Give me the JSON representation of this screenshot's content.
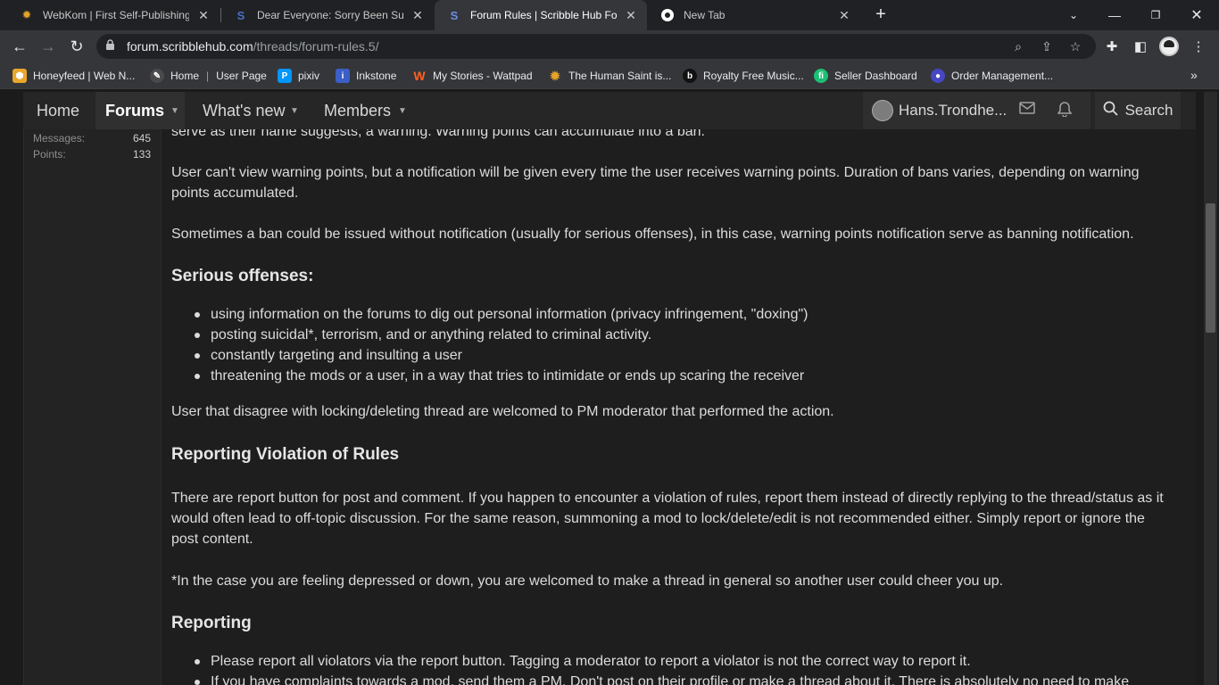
{
  "browser": {
    "tabs": [
      {
        "title": "WebKom | First Self-Publishing Pl",
        "favicon": "sun-icon",
        "active": false
      },
      {
        "title": "Dear Everyone: Sorry Been Such A",
        "favicon": "scribble-icon",
        "active": false
      },
      {
        "title": "Forum Rules | Scribble Hub Forum",
        "favicon": "scribble-icon",
        "active": true
      },
      {
        "title": "New Tab",
        "favicon": "chrome-icon",
        "active": false
      }
    ],
    "url_host": "forum.scribblehub.com",
    "url_path": "/threads/forum-rules.5/",
    "bookmarks": [
      {
        "label": "Honeyfeed | Web N...",
        "icon": "honeyfeed-icon",
        "color": "#e9a72b"
      },
      {
        "label": "Home",
        "icon": "home-icon",
        "color": "#4a4a4a"
      },
      {
        "label": "User Page",
        "icon": "",
        "color": ""
      },
      {
        "label": "pixiv",
        "icon": "pixiv-icon",
        "color": "#0096fa"
      },
      {
        "label": "Inkstone",
        "icon": "inkstone-icon",
        "color": "#3b5ec7"
      },
      {
        "label": "My Stories - Wattpad",
        "icon": "wattpad-icon",
        "color": "#ff6122"
      },
      {
        "label": "The Human Saint is...",
        "icon": "sun-icon",
        "color": "#c7922a"
      },
      {
        "label": "Royalty Free Music...",
        "icon": "music-icon",
        "color": "#111111"
      },
      {
        "label": "Seller Dashboard",
        "icon": "fiverr-icon",
        "color": "#1dbf73"
      },
      {
        "label": "Order Management...",
        "icon": "order-icon",
        "color": "#4747c2"
      }
    ]
  },
  "site_nav": {
    "home": "Home",
    "forums": "Forums",
    "whats_new": "What's new",
    "members": "Members",
    "username": "Hans.Trondhe...",
    "search": "Search"
  },
  "user_stats": {
    "messages_label": "Messages:",
    "messages_value": "645",
    "points_label": "Points:",
    "points_value": "133"
  },
  "article": {
    "p_warning_tail": "serve as their name suggests, a warning. Warning points can accumulate into a ban.",
    "p_user_cant_view": "User can't view warning points, but a notification will be given every time the user receives warning points. Duration of bans varies, depending on warning points accumulated.",
    "p_sometimes": "Sometimes a ban could be issued without notification (usually for serious offenses), in this case, warning points notification serve as banning notification.",
    "h_serious": "Serious offenses:",
    "serious_items": [
      "using information on the forums to dig out personal information (privacy infringement, \"doxing\")",
      "posting suicidal*, terrorism, and or anything related to criminal activity.",
      "constantly targeting and insulting a user",
      "threatening the mods or a user, in a way that tries to intimidate or ends up scaring the receiver"
    ],
    "p_disagree": "User that disagree with locking/deleting thread are welcomed to PM moderator that performed the action.",
    "h_reporting_violation": "Reporting Violation of Rules",
    "p_report_button": "There are report button for post and comment. If you happen to encounter a violation of rules, report them instead of directly replying to the thread/status as it would often lead to off-topic discussion. For the same reason, summoning a mod to lock/delete/edit is not recommended either. Simply report or ignore the post content.",
    "p_depressed": "*In the case you are feeling depressed or down, you are welcomed to make a thread in general so another user could cheer you up.",
    "h_reporting": "Reporting",
    "reporting_items": [
      "Please report all violators via the report button. Tagging a moderator to report a violator is not the correct way to report it.",
      "If you have complaints towards a mod, send them a PM. Don't post on their profile or make a thread about it. There is absolutely no need to make"
    ]
  }
}
